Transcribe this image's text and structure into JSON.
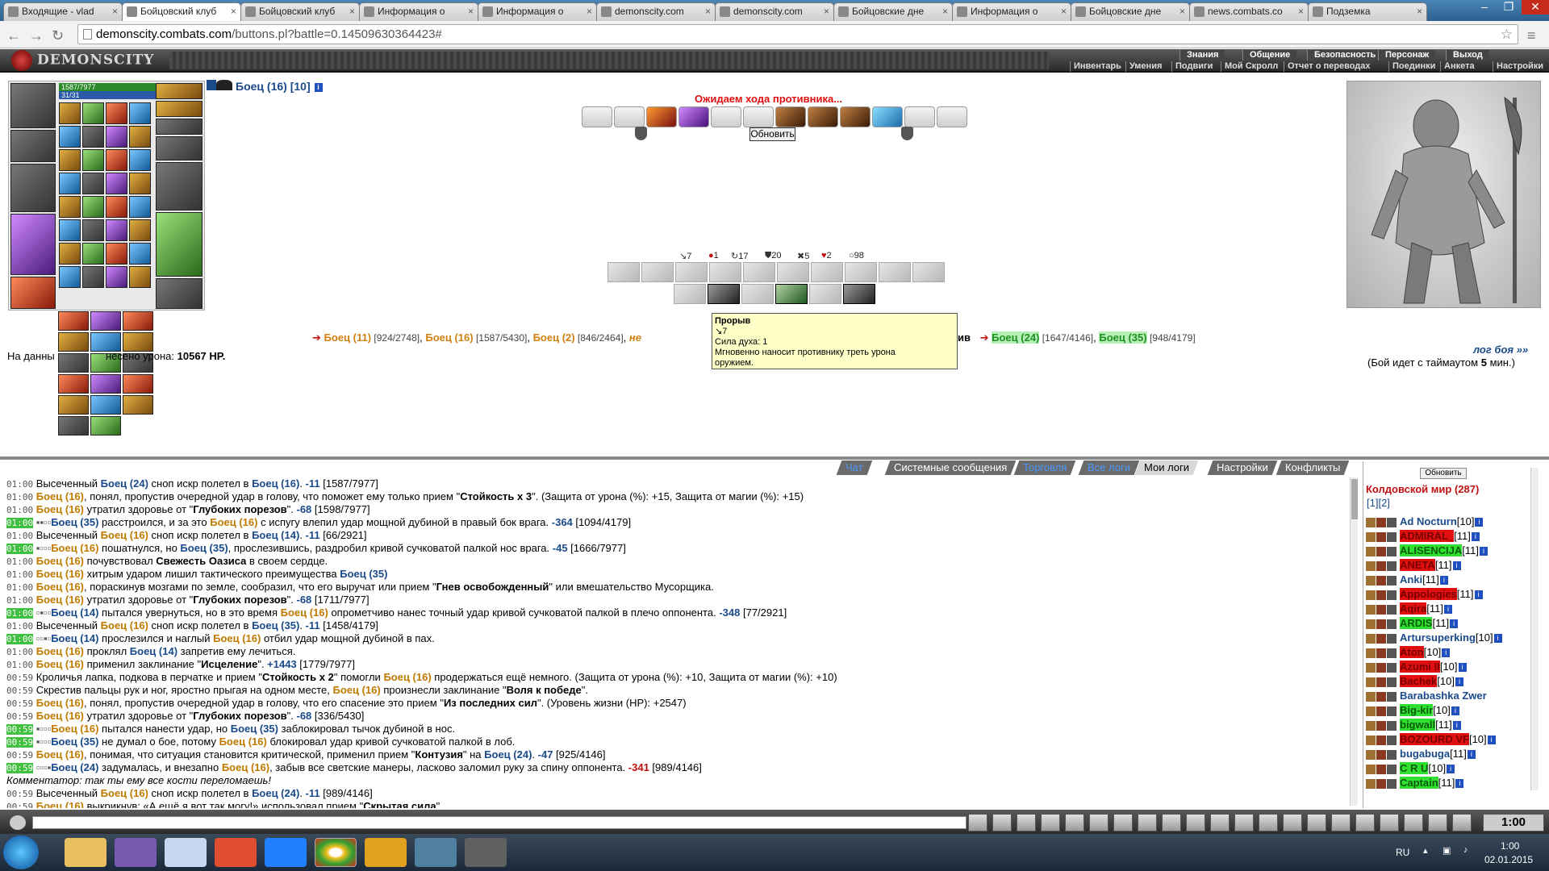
{
  "browser": {
    "tabs": [
      {
        "label": "Входящие - vlad",
        "active": false
      },
      {
        "label": "Бойцовский клуб",
        "active": true
      },
      {
        "label": "Бойцовский клуб",
        "active": false
      },
      {
        "label": "Информация о",
        "active": false
      },
      {
        "label": "Информация о",
        "active": false
      },
      {
        "label": "demonscity.com",
        "active": false
      },
      {
        "label": "demonscity.com",
        "active": false
      },
      {
        "label": "Бойцовские дне",
        "active": false
      },
      {
        "label": "Информация о",
        "active": false
      },
      {
        "label": "Бойцовские дне",
        "active": false
      },
      {
        "label": "news.combats.co",
        "active": false
      },
      {
        "label": "Подземка",
        "active": false
      }
    ],
    "url_domain": "demonscity.combats.com",
    "url_path": "/buttons.pl?battle=0.14509630364423#"
  },
  "game": {
    "logo": "DEMONSCITY",
    "top_menu": [
      "Знания",
      "Общение",
      "Безопасность",
      "Персонаж",
      "Выход"
    ],
    "sub_menu": [
      "Инвентарь",
      "Умения",
      "Подвиги",
      "Мой Скролл",
      "Отчет о переводах",
      "Поединки",
      "Анкета",
      "Настройки"
    ],
    "hp": "1587/7977",
    "mp": "31/31",
    "fighter_name": "Боец",
    "fighter_level": "(16)",
    "fighter_rank": "[10]",
    "waiting": "Ожидаем хода противника...",
    "refresh": "Обновить",
    "stats": [
      "7",
      "1",
      "17",
      "20",
      "5",
      "2",
      "98"
    ],
    "tooltip": {
      "title": "Прорыв",
      "line1": "7",
      "line2": "Сила духа: 1",
      "line3": "Мгновенно наносит противнику треть урона",
      "line4": "оружием."
    },
    "team_left": [
      {
        "name": "Боец (11)",
        "hp": "[924/2748]"
      },
      {
        "name": "Боец (16)",
        "hp": "[1587/5430]"
      },
      {
        "name": "Боец (2)",
        "hp": "[846/2464]"
      }
    ],
    "team_left_tail": "не",
    "team_mid": "ив",
    "team_right": [
      {
        "name": "Боец (24)",
        "hp": "[1647/4146]"
      },
      {
        "name": "Боец (35)",
        "hp": "[948/4179]"
      }
    ],
    "damage_prefix": "На данны",
    "damage_text": "несено урона:",
    "damage_value": "10567 HP.",
    "log_link": "лог боя »»",
    "timeout_pre": "(Бой идет с таймаутом",
    "timeout_val": "5",
    "timeout_post": "мин.)"
  },
  "chat": {
    "tabs": [
      {
        "label": "Чат",
        "style": "blue"
      },
      {
        "label": "Системные сообщения",
        "style": "normal"
      },
      {
        "label": "Торговля",
        "style": "blue"
      },
      {
        "label": "Все логи",
        "style": "blue"
      },
      {
        "label": "Мои логи",
        "style": "active"
      },
      {
        "label": "Настройки",
        "style": "normal"
      },
      {
        "label": "Конфликты",
        "style": "normal"
      }
    ],
    "lines": [
      {
        "t": "01:00",
        "g": false,
        "html": "Высеченный <span class='nb'>Боец (24)</span> сноп искр полетел в <span class='nb'>Боец (16)</span>. <span class='dm'>-11</span> [1587/7977]"
      },
      {
        "t": "01:00",
        "g": false,
        "html": "<span class='nm'>Боец (16)</span>, понял, пропустив очередной удар в голову, что поможет ему только прием \"<b>Стойкость х 3</b>\". (Защита от урона (%): +15, Защита от магии (%): +15)"
      },
      {
        "t": "01:00",
        "g": false,
        "html": "<span class='nm'>Боец (16)</span> утратил здоровье от \"<b>Глубоких порезов</b>\". <span class='dm'>-68</span> [1598/7977]"
      },
      {
        "t": "01:00",
        "g": true,
        "html": "<span class='tag'>▪▪▫▫</span><span class='nb'>Боец (35)</span> расстроился, и за это <span class='nm'>Боец (16)</span> с испугу влепил удар мощной дубиной в правый бок врага. <span class='dm'>-364</span> [1094/4179]"
      },
      {
        "t": "01:00",
        "g": false,
        "html": "Высеченный <span class='nm'>Боец (16)</span> сноп искр полетел в <span class='nb'>Боец (14)</span>. <span class='dm'>-11</span> [66/2921]"
      },
      {
        "t": "01:00",
        "g": true,
        "html": "<span class='tag'>▪▫▫▫</span><span class='nm'>Боец (16)</span> пошатнулся, но <span class='nb'>Боец (35)</span>, прослезившись, раздробил кривой сучковатой палкой нос врага. <span class='dm'>-45</span> [1666/7977]"
      },
      {
        "t": "01:00",
        "g": false,
        "html": "<span class='nm'>Боец (16)</span> почувствовал <b>Свежесть Оазиса</b> в своем сердце."
      },
      {
        "t": "01:00",
        "g": false,
        "html": "<span class='nm'>Боец (16)</span> хитрым ударом лишил тактического преимущества <span class='nb'>Боец (35)</span>"
      },
      {
        "t": "01:00",
        "g": false,
        "html": "<span class='nm'>Боец (16)</span>, пораскинув мозгами по земле, сообразил, что его выручат или прием \"<b>Гнев освобожденный</b>\" или вмешательство Мусорщика."
      },
      {
        "t": "01:00",
        "g": false,
        "html": "<span class='nm'>Боец (16)</span> утратил здоровье от \"<b>Глубоких порезов</b>\". <span class='dm'>-68</span> [1711/7977]"
      },
      {
        "t": "01:00",
        "g": true,
        "html": "<span class='tag'>▫▪▫▫</span><span class='nb'>Боец (14)</span> пытался увернуться, но в это время <span class='nm'>Боец (16)</span> опрометчиво нанес точный удар кривой сучковатой палкой в плечо оппонента. <span class='dm'>-348</span> [77/2921]"
      },
      {
        "t": "01:00",
        "g": false,
        "html": "Высеченный <span class='nm'>Боец (16)</span> сноп искр полетел в <span class='nb'>Боец (35)</span>. <span class='dm'>-11</span> [1458/4179]"
      },
      {
        "t": "01:00",
        "g": true,
        "html": "<span class='tag'>▫▫▪▫</span><span class='nb'>Боец (14)</span> прослезился и наглый <span class='nm'>Боец (16)</span> отбил удар мощной дубиной в пах."
      },
      {
        "t": "01:00",
        "g": false,
        "html": "<span class='nm'>Боец (16)</span> проклял <span class='nb'>Боец (14)</span> запретив ему лечиться."
      },
      {
        "t": "01:00",
        "g": false,
        "html": "<span class='nm'>Боец (16)</span> применил заклинание \"<b>Исцеление</b>\". <span class='hv'>+1443</span> [1779/7977]"
      },
      {
        "t": "00:59",
        "g": false,
        "html": "Кроличья лапка, подкова в перчатке и прием \"<b>Стойкость х 2</b>\" помогли <span class='nm'>Боец (16)</span> продержаться ещё немного. (Защита от урона (%): +10, Защита от магии (%): +10)"
      },
      {
        "t": "00:59",
        "g": false,
        "html": "Скрестив пальцы рук и ног, яростно прыгая на одном месте, <span class='nm'>Боец (16)</span> произнесли заклинание \"<b>Воля к победе</b>\"."
      },
      {
        "t": "00:59",
        "g": false,
        "html": "<span class='nm'>Боец (16)</span>, понял, пропустив очередной удар в голову, что его спасение это прием \"<b>Из последних сил</b>\". (Уровень жизни (HP): +2547)"
      },
      {
        "t": "00:59",
        "g": false,
        "html": "<span class='nm'>Боец (16)</span> утратил здоровье от \"<b>Глубоких порезов</b>\". <span class='dm'>-68</span> [336/5430]"
      },
      {
        "t": "00:59",
        "g": true,
        "html": "<span class='tag'>▪▫▫▫</span><span class='nm'>Боец (16)</span> пытался нанести удар, но <span class='nb'>Боец (35)</span> заблокировал тычок дубиной в нос."
      },
      {
        "t": "00:59",
        "g": true,
        "html": "<span class='tag'>▪▫▫▫</span><span class='nb'>Боец (35)</span> не думал о бое, потому <span class='nm'>Боец (16)</span> блокировал удар кривой сучковатой палкой в лоб."
      },
      {
        "t": "00:59",
        "g": false,
        "html": "<span class='nm'>Боец (16)</span>, понимая, что ситуация становится критической, применил прием \"<b>Контузия</b>\" на <span class='nb'>Боец (24)</span>. <span class='dm'>-47</span> [925/4146]"
      },
      {
        "t": "00:59",
        "g": true,
        "html": "<span class='tag'>▫▫▫▪</span><span class='nb'>Боец (24)</span> задумалась, и внезапно <span class='nm'>Боец (16)</span>, забыв все светские манеры, ласково заломил руку за спину оппонента. <span class='rd'>-341</span> [989/4146]"
      },
      {
        "t": "",
        "g": false,
        "html": "<span class='cm'>Комментатор: так ты ему все кости переломаешь!</span>"
      },
      {
        "t": "00:59",
        "g": false,
        "html": "Высеченный <span class='nm'>Боец (16)</span> сноп искр полетел в <span class='nb'>Боец (24)</span>. <span class='dm'>-11</span> [989/4146]"
      },
      {
        "t": "00:59",
        "g": false,
        "html": "<span class='nm'>Боец (16)</span> выкрикнув: «А ещё я вот так могу!» использовал прием \"<b>Скрытая сила</b>\""
      }
    ]
  },
  "sidebar": {
    "refresh": "Обновить",
    "title": "Колдовской мир (287)",
    "pages": "[1][2]",
    "players": [
      {
        "name": "Ad Nocturn",
        "lvl": "[10]",
        "style": "normal"
      },
      {
        "name": "ADMIRAL_",
        "lvl": "[11]",
        "style": "red"
      },
      {
        "name": "ALISENCIJA",
        "lvl": "[11]",
        "style": "green"
      },
      {
        "name": "ANETA",
        "lvl": "[11]",
        "style": "red"
      },
      {
        "name": "Anki",
        "lvl": "[11]",
        "style": "normal"
      },
      {
        "name": "Appologies",
        "lvl": "[11]",
        "style": "red"
      },
      {
        "name": "Aqira",
        "lvl": "[11]",
        "style": "red"
      },
      {
        "name": "ARDIS",
        "lvl": "[11]",
        "style": "green"
      },
      {
        "name": "Artursuperking",
        "lvl": "[10]",
        "style": "normal"
      },
      {
        "name": "Aton",
        "lvl": "[10]",
        "style": "red"
      },
      {
        "name": "Azumi II",
        "lvl": "[10]",
        "style": "red"
      },
      {
        "name": "Bachek",
        "lvl": "[10]",
        "style": "red"
      },
      {
        "name": "Barabashka Zwer",
        "lvl": "",
        "style": "normal"
      },
      {
        "name": "Big-kir",
        "lvl": "[10]",
        "style": "green"
      },
      {
        "name": "bigwall",
        "lvl": "[11]",
        "style": "green"
      },
      {
        "name": "BOZOURD VF",
        "lvl": "[10]",
        "style": "red"
      },
      {
        "name": "bugabuga",
        "lvl": "[11]",
        "style": "normal"
      },
      {
        "name": "C R U",
        "lvl": "[10]",
        "style": "green"
      },
      {
        "name": "Captain",
        "lvl": "[11]",
        "style": "green"
      }
    ]
  },
  "clock": "1:00",
  "taskbar": {
    "lang": "RU",
    "time": "1:00",
    "date": "02.01.2015"
  }
}
